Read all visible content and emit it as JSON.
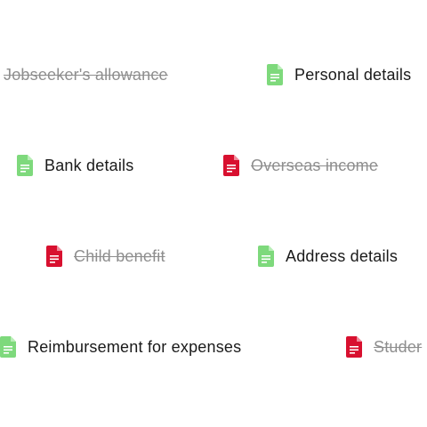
{
  "colors": {
    "pending_icon": "#7ed97c",
    "done_icon": "#d8102f",
    "pending_text": "#1a1a1a",
    "done_text": "#8e8e8e"
  },
  "rows": [
    [
      {
        "label": "Jobseeker's allowance",
        "state": "done",
        "icon": "none"
      },
      {
        "label": "Personal details",
        "state": "pending",
        "icon": "document-icon"
      }
    ],
    [
      {
        "label": "Bank details",
        "state": "pending",
        "icon": "document-icon"
      },
      {
        "label": "Overseas income",
        "state": "done",
        "icon": "document-icon"
      }
    ],
    [
      {
        "label": "Child benefit",
        "state": "done",
        "icon": "document-icon"
      },
      {
        "label": "Address details",
        "state": "pending",
        "icon": "document-icon"
      }
    ],
    [
      {
        "label": "Reimbursement for expenses",
        "state": "pending",
        "icon": "document-icon"
      },
      {
        "label": "Studer",
        "state": "done",
        "icon": "document-icon"
      }
    ]
  ]
}
